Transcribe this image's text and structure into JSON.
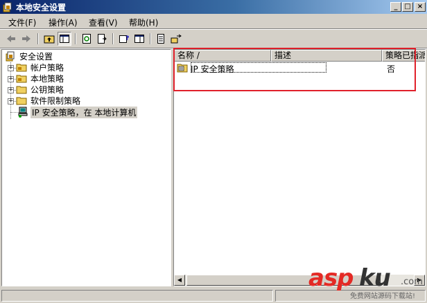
{
  "window": {
    "title": "本地安全设置",
    "controls": {
      "minimize": "_",
      "maximize": "□",
      "close": "×"
    }
  },
  "menu": {
    "items": [
      {
        "label": "文件(F)"
      },
      {
        "label": "操作(A)"
      },
      {
        "label": "查看(V)"
      },
      {
        "label": "帮助(H)"
      }
    ]
  },
  "toolbar": {
    "icons": [
      "back-arrow-icon",
      "forward-arrow-icon",
      "up-folder-icon",
      "show-hide-tree-icon",
      "refresh-icon",
      "export-list-icon",
      "properties-help-icon",
      "console-tree-icon",
      "new-policy-icon",
      "assign-icon"
    ]
  },
  "tree": {
    "root": {
      "label": "安全设置"
    },
    "children": [
      {
        "label": "帐户策略",
        "expander": "+"
      },
      {
        "label": "本地策略",
        "expander": "+"
      },
      {
        "label": "公钥策略",
        "expander": "+"
      },
      {
        "label": "软件限制策略",
        "expander": "+"
      },
      {
        "label": "IP 安全策略，在 本地计算机",
        "selected": true
      }
    ]
  },
  "list": {
    "columns": [
      {
        "label": "名称 /"
      },
      {
        "label": "描述"
      },
      {
        "label": "策略已指派"
      }
    ],
    "rows": [
      {
        "name": "IP 安全策略",
        "description": "",
        "assigned": "否"
      }
    ]
  },
  "watermark": {
    "brand_a": "asp",
    "brand_b": "ku",
    "brand_c": ".com",
    "tagline": "免费网站源码下载站!"
  },
  "colors": {
    "title_gradient_start": "#0a246a",
    "title_gradient_end": "#a6caf0",
    "highlight_box": "#e0202a",
    "watermark_red": "#e42a25"
  }
}
